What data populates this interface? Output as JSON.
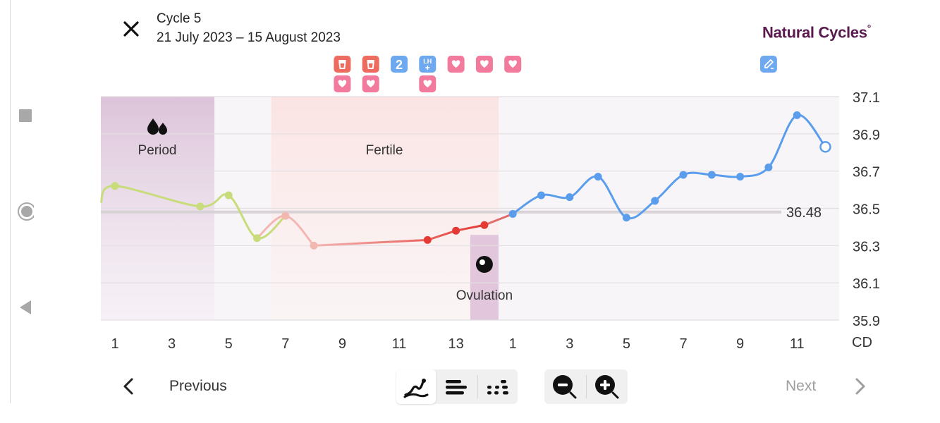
{
  "header": {
    "cycle_title": "Cycle 5",
    "cycle_dates": "21 July 2023 – 15 August 2023",
    "brand": "Natural Cycles",
    "brand_mark": "°"
  },
  "labels": {
    "period": "Period",
    "fertile": "Fertile",
    "ovulation": "Ovulation",
    "cover_line_value": "36.48"
  },
  "bottom": {
    "previous_label": "Previous",
    "next_label": "Next"
  },
  "colors": {
    "period_green": "#c8dc7c",
    "fertile_pink": "#f3b7b2",
    "fertile_red": "#e53935",
    "luteal_blue": "#5b9ded",
    "brand": "#5a1a4f",
    "period_band": "#dcc3d9",
    "fertile_band": "#fbe3e3",
    "badge_red": "#ee6b5f",
    "badge_pink": "#f27a9c",
    "badge_blue": "#6ea9f0"
  },
  "icons": {
    "close": "close-icon",
    "period": "drops-icon",
    "ovulation": "egg-icon",
    "prev": "chevron-left-icon",
    "next": "chevron-right-icon",
    "view_graph": "graph-view-icon",
    "view_list": "list-view-icon",
    "view_scatter": "scatter-view-icon",
    "zoom_out": "zoom-out-icon",
    "zoom_in": "zoom-in-icon"
  },
  "chart_data": {
    "type": "line",
    "ylabel": "",
    "xlabel": "CD",
    "ylim": [
      35.9,
      37.1
    ],
    "y_ticks": [
      "37.1",
      "36.9",
      "36.7",
      "36.5",
      "36.3",
      "36.1",
      "35.9"
    ],
    "x_tick_labels": [
      "1",
      "3",
      "5",
      "7",
      "9",
      "11",
      "13",
      "1",
      "3",
      "5",
      "7",
      "9",
      "11"
    ],
    "x_tick_days": [
      1,
      3,
      5,
      7,
      9,
      11,
      13,
      15,
      17,
      19,
      21,
      23,
      25
    ],
    "cover_line": 36.48,
    "period_days": [
      1,
      4
    ],
    "fertile_days": [
      7,
      14
    ],
    "ovulation_day": 14,
    "badges": [
      {
        "day": 9,
        "icons": [
          "test-icon",
          "heart-icon"
        ]
      },
      {
        "day": 10,
        "icons": [
          "test-icon",
          "heart-icon"
        ]
      },
      {
        "day": 11,
        "icons": [
          "number-badge"
        ],
        "text": "2"
      },
      {
        "day": 12,
        "icons": [
          "lh-test-icon",
          "heart-icon"
        ],
        "text": "LH"
      },
      {
        "day": 13,
        "icons": [
          "heart-icon"
        ]
      },
      {
        "day": 14,
        "icons": [
          "heart-icon"
        ]
      },
      {
        "day": 15,
        "icons": [
          "heart-icon"
        ]
      },
      {
        "day": 24,
        "icons": [
          "note-icon"
        ]
      }
    ],
    "series": [
      {
        "values": [
          {
            "day": 1,
            "temp": 36.62,
            "phase": "period"
          },
          {
            "day": 4,
            "temp": 36.51,
            "phase": "period"
          },
          {
            "day": 5,
            "temp": 36.57,
            "phase": "period"
          },
          {
            "day": 6,
            "temp": 36.34,
            "phase": "period"
          },
          {
            "day": 7,
            "temp": 36.46,
            "phase": "fertile-light"
          },
          {
            "day": 8,
            "temp": 36.3,
            "phase": "fertile-light"
          },
          {
            "day": 12,
            "temp": 36.33,
            "phase": "fertile"
          },
          {
            "day": 13,
            "temp": 36.38,
            "phase": "fertile"
          },
          {
            "day": 14,
            "temp": 36.41,
            "phase": "fertile"
          },
          {
            "day": 15,
            "temp": 36.47,
            "phase": "luteal"
          },
          {
            "day": 16,
            "temp": 36.57,
            "phase": "luteal"
          },
          {
            "day": 17,
            "temp": 36.56,
            "phase": "luteal"
          },
          {
            "day": 18,
            "temp": 36.67,
            "phase": "luteal"
          },
          {
            "day": 19,
            "temp": 36.45,
            "phase": "luteal"
          },
          {
            "day": 20,
            "temp": 36.54,
            "phase": "luteal"
          },
          {
            "day": 21,
            "temp": 36.68,
            "phase": "luteal"
          },
          {
            "day": 22,
            "temp": 36.68,
            "phase": "luteal"
          },
          {
            "day": 23,
            "temp": 36.67,
            "phase": "luteal"
          },
          {
            "day": 24,
            "temp": 36.72,
            "phase": "luteal"
          },
          {
            "day": 25,
            "temp": 37.0,
            "phase": "luteal"
          },
          {
            "day": 26,
            "temp": 36.83,
            "phase": "luteal",
            "hollow": true
          }
        ]
      }
    ]
  }
}
